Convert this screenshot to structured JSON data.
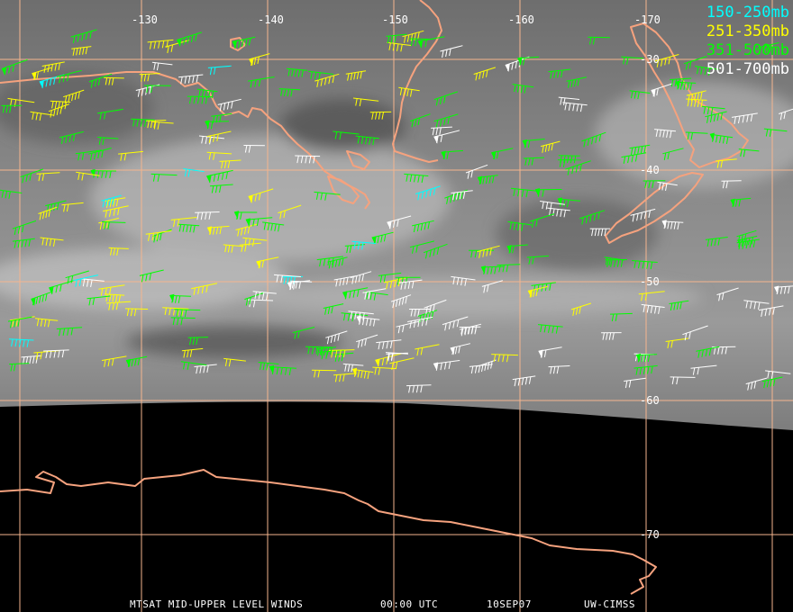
{
  "legend": [
    {
      "label": "150-250mb",
      "color": "#00ffff"
    },
    {
      "label": "251-350mb",
      "color": "#ffff00"
    },
    {
      "label": "351-500mb",
      "color": "#00ff00"
    },
    {
      "label": "501-700mb",
      "color": "#ffffff"
    }
  ],
  "longitude_labels": [
    "-130",
    "-140",
    "-150",
    "-160",
    "-170"
  ],
  "latitude_labels": [
    "-30",
    "-40",
    "-50",
    "-60",
    "-70"
  ],
  "footer": {
    "product": "MTSAT MID-UPPER LEVEL WINDS",
    "time": "00:00 UTC",
    "date": "10SEP07",
    "source": "UW-CIMSS"
  },
  "colors": {
    "grid": "#f5b58e",
    "coastline": "#f5a27e",
    "satellite_gray": "#7a7a7a",
    "space": "#000000"
  }
}
